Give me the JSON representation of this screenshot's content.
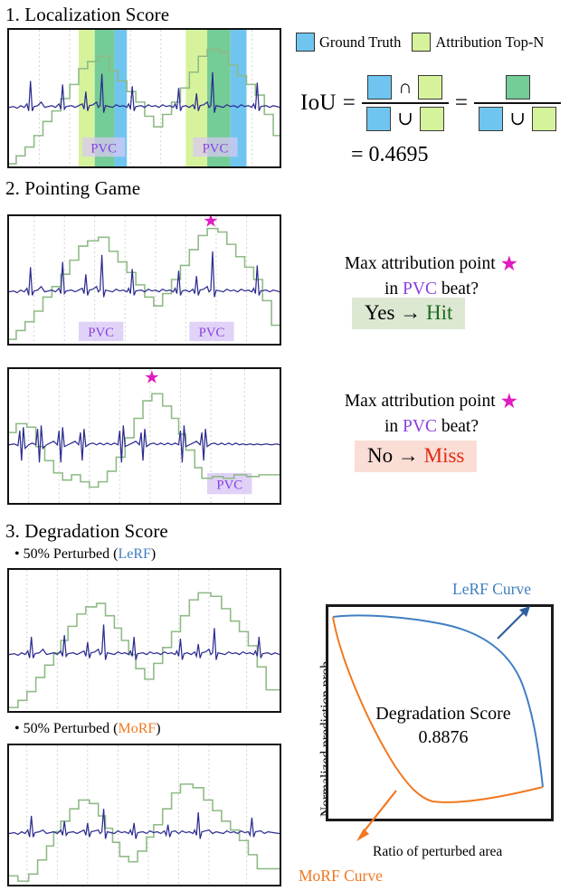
{
  "sections": {
    "s1_title": "1. Localization Score",
    "s2_title": "2. Pointing Game",
    "s3_title": "3. Degradation Score"
  },
  "legend": {
    "ground_truth": {
      "label": "Ground Truth",
      "color": "#6FC5EF"
    },
    "attribution": {
      "label": "Attribution Top-N",
      "color": "#D6F39C"
    },
    "overlap_color": "#74CC96"
  },
  "iou": {
    "label": "IoU",
    "equals": "=",
    "intersection_op": "∩",
    "union_op": "∪",
    "result_line": "= 0.4695",
    "value": 0.4695
  },
  "pointing_game": {
    "star_glyph": "★",
    "star_color": "#E01CC0",
    "question_line1_pre": "Max attribution point ",
    "question_line2_pre": "in ",
    "question_line2_mid": "PVC",
    "question_line2_post": " beat?",
    "case_hit": {
      "answer": "Yes",
      "arrow": "→",
      "outcome": "Hit",
      "bg": "#DCE8D2",
      "fg": "#1B6B1B"
    },
    "case_miss": {
      "answer": "No",
      "arrow": "→",
      "outcome": "Miss",
      "bg": "#FADDD5",
      "fg": "#E02A12"
    }
  },
  "degradation": {
    "bullet_lerf_pre": "• 50% Perturbed (",
    "bullet_lerf_name": "LeRF",
    "bullet_lerf_post": ")",
    "bullet_morf_pre": "• 50% Perturbed (",
    "bullet_morf_name": "MoRF",
    "bullet_morf_post": ")",
    "lerf_color": "#3F7FC1",
    "morf_color": "#F07820",
    "lerf_caption": "LeRF Curve",
    "morf_caption": "MoRF Curve",
    "score_title": "Degradation Score",
    "score_value": "0.8876"
  },
  "annotations": {
    "pvc_label": "PVC",
    "pvc_color": "#8A3FE0",
    "pvc_bg": "#D9C7F5"
  },
  "colors": {
    "ecg_signal": "#2B2B8F",
    "attribution_curve": "#8FBA86",
    "panel_border": "#111111",
    "gridline": "#CCCCCC"
  },
  "chart_data": {
    "type": "line",
    "title": "Degradation Score",
    "xlabel": "Ratio of perturbed area",
    "ylabel": "Normalized prediction prob.",
    "xlim": [
      0,
      1
    ],
    "ylim": [
      0,
      1
    ],
    "grid": false,
    "legend_position": "external-annotations",
    "annotations": [
      "LeRF Curve",
      "MoRF Curve",
      "Degradation Score 0.8876"
    ],
    "series": [
      {
        "name": "LeRF Curve",
        "color": "#3F7FC1",
        "x": [
          0.0,
          0.05,
          0.12,
          0.2,
          0.3,
          0.4,
          0.5,
          0.6,
          0.7,
          0.78,
          0.85,
          0.9,
          0.94,
          0.97,
          1.0
        ],
        "y": [
          0.96,
          0.965,
          0.963,
          0.958,
          0.95,
          0.94,
          0.925,
          0.905,
          0.872,
          0.82,
          0.7,
          0.54,
          0.36,
          0.19,
          0.085
        ]
      },
      {
        "name": "MoRF Curve",
        "color": "#F07820",
        "x": [
          0.0,
          0.03,
          0.07,
          0.12,
          0.18,
          0.25,
          0.33,
          0.42,
          0.5,
          0.58,
          0.66,
          0.75,
          0.85,
          0.93,
          1.0
        ],
        "y": [
          0.96,
          0.83,
          0.66,
          0.5,
          0.37,
          0.265,
          0.19,
          0.14,
          0.11,
          0.095,
          0.09,
          0.098,
          0.11,
          0.095,
          0.085
        ]
      }
    ]
  },
  "ecg_panels": {
    "panel1_name": "localization-ecg",
    "panel2_name": "pointing-hit-ecg",
    "panel3_name": "pointing-miss-ecg",
    "panel4_name": "lerf-perturbed-ecg",
    "panel5_name": "morf-perturbed-ecg"
  }
}
